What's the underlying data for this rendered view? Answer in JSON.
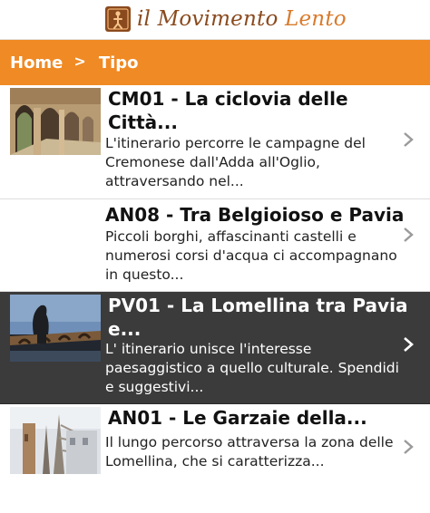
{
  "header": {
    "logo_word1": "il Movimento",
    "logo_word2": "Lento"
  },
  "breadcrumb": {
    "home": "Home",
    "separator": ">",
    "current": "Tipo"
  },
  "items": [
    {
      "title": "CM01 - La ciclovia delle Città...",
      "desc": "L'itinerario percorre le campagne del Cremonese dall'Adda all'Oglio, attraversando nel...",
      "selected": false
    },
    {
      "title": "AN08 - Tra Belgioioso e Pavia",
      "desc": "Piccoli borghi, affascinanti castelli e numerosi corsi d'acqua ci accompagnano in questo...",
      "selected": false
    },
    {
      "title": "PV01 - La Lomellina tra Pavia e...",
      "desc": "L' itinerario unisce l'interesse paesaggistico a quello culturale. Spendidi e suggestivi...",
      "selected": true
    },
    {
      "title": "AN01 - Le Garzaie della...",
      "desc": "Il lungo percorso attraversa la zona delle Lomellina, che si caratterizza...",
      "selected": false
    }
  ],
  "colors": {
    "accent": "#f08a24",
    "selected_bg": "#3b3b3b",
    "logo_dark": "#8a4a1e",
    "logo_light": "#d97a2b"
  }
}
